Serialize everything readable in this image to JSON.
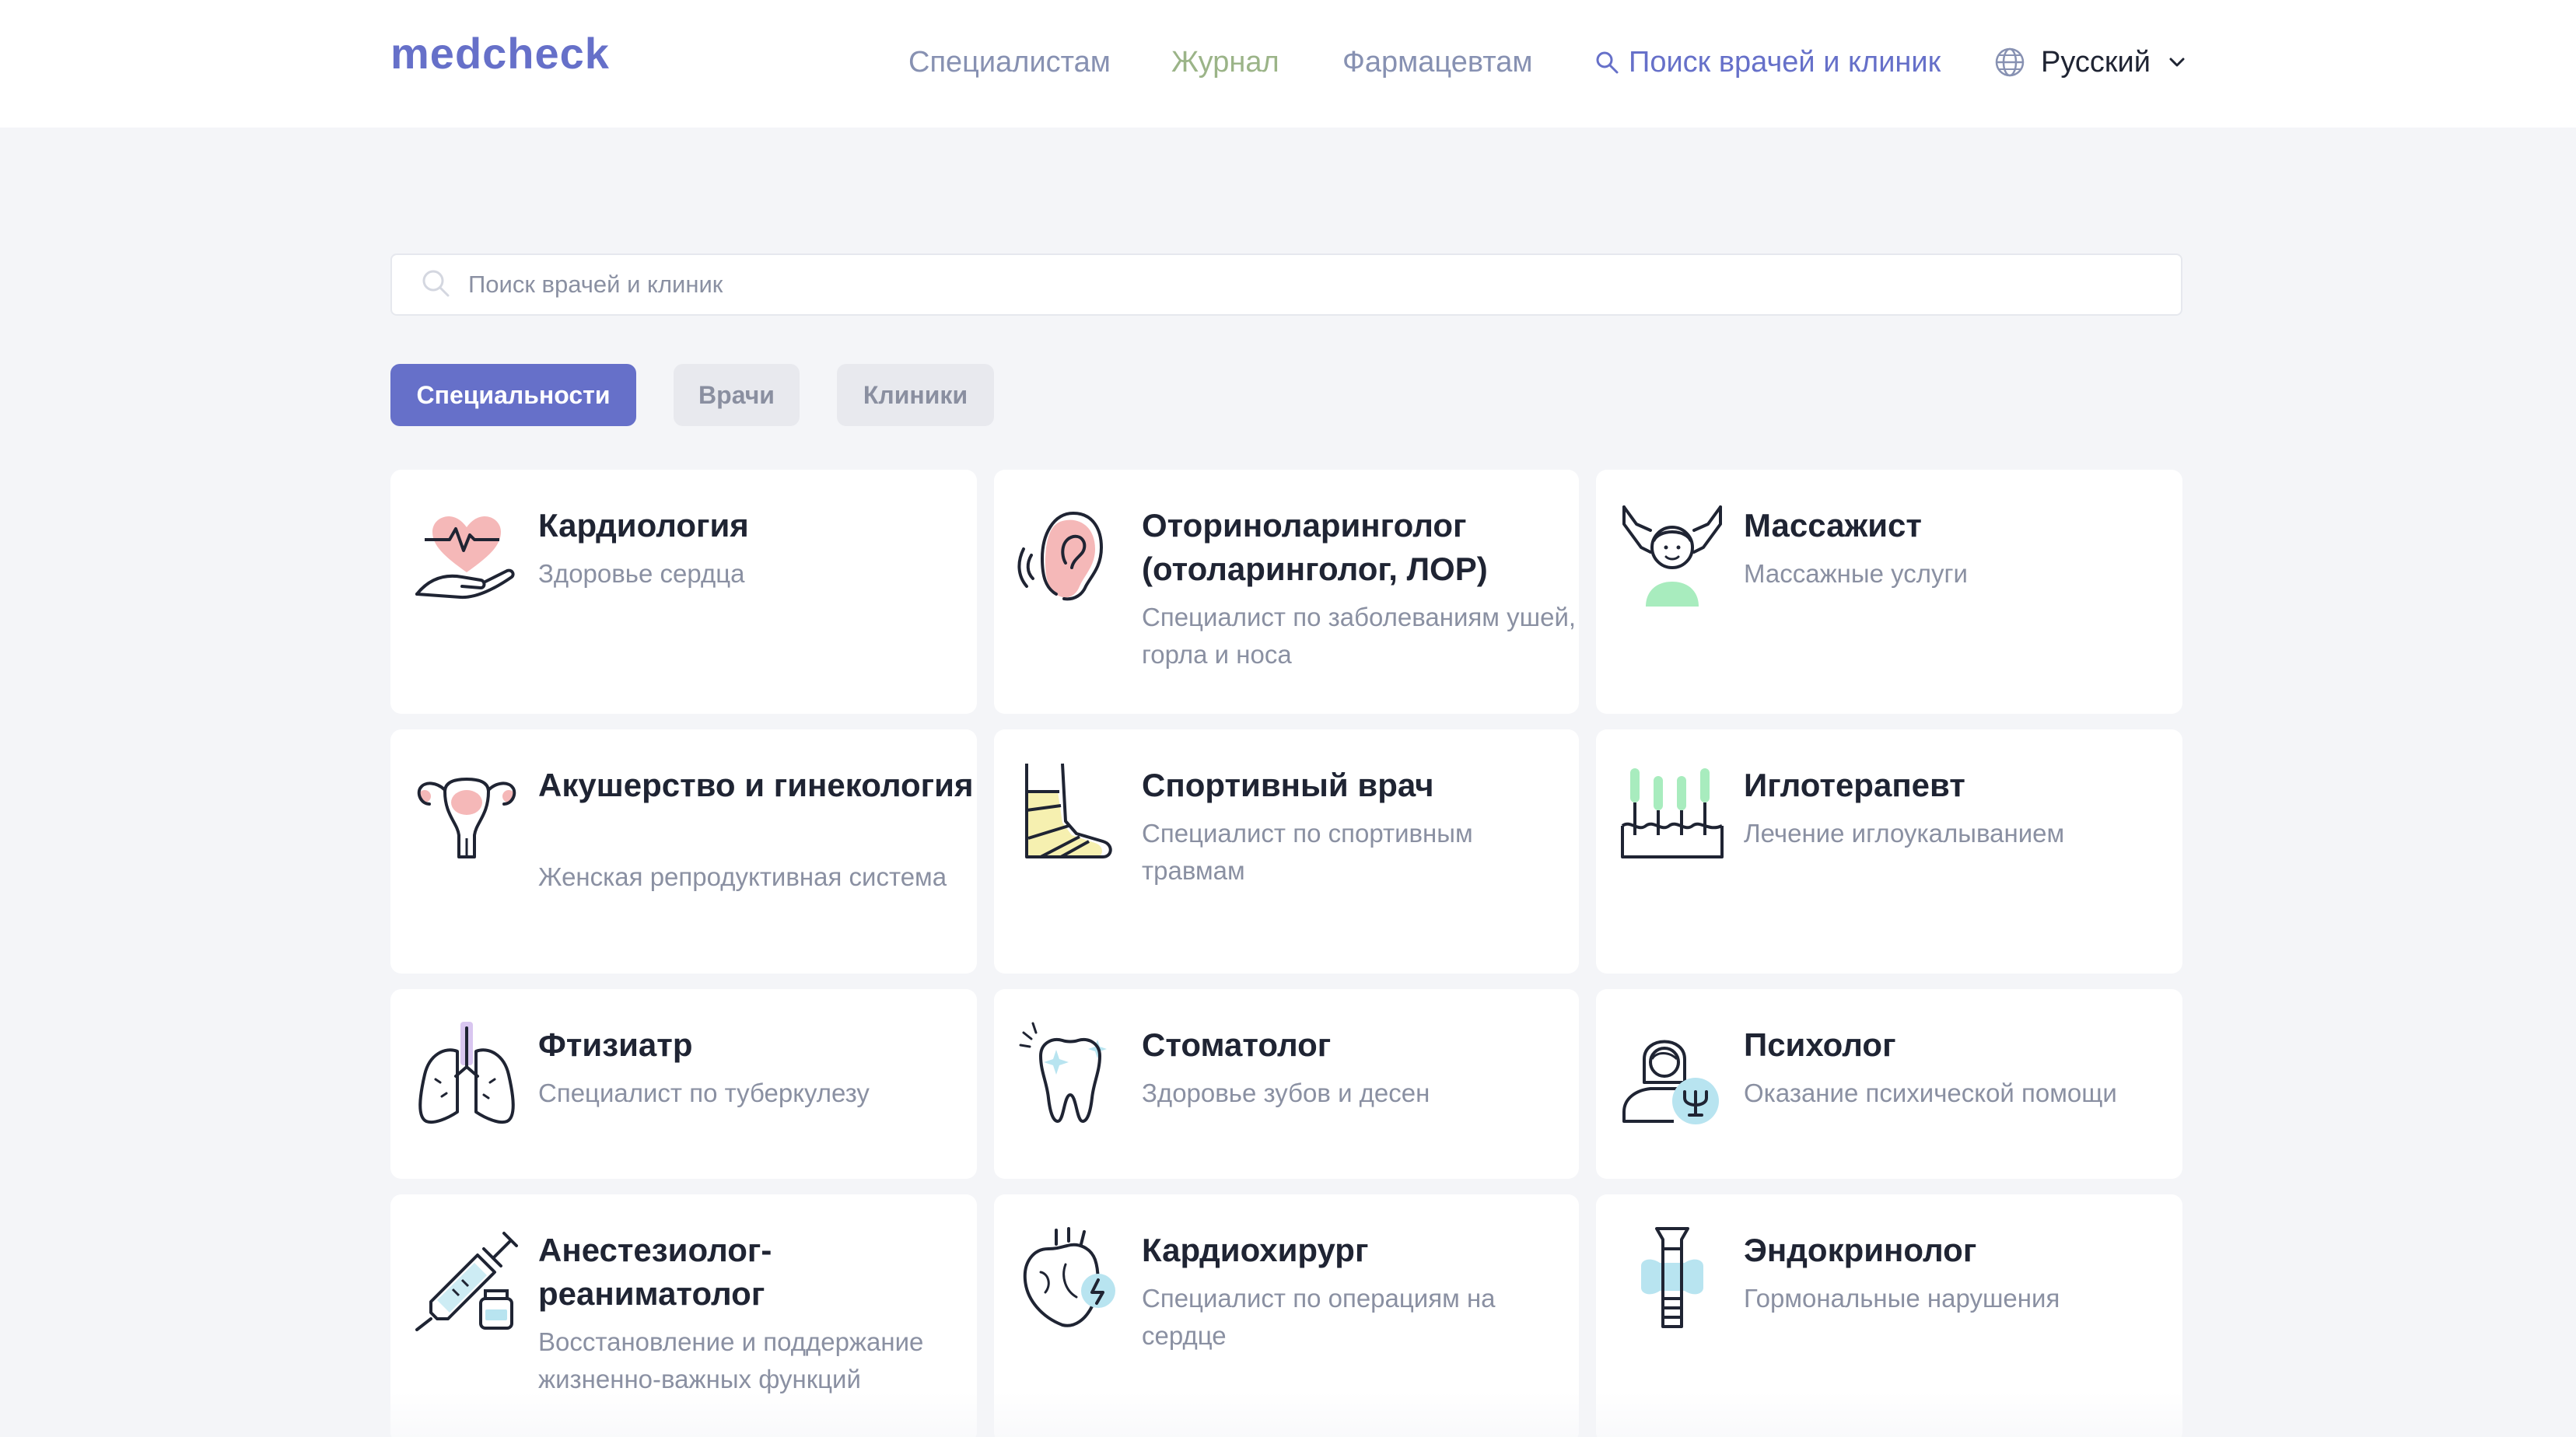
{
  "header": {
    "logo": "medcheck",
    "nav": {
      "specialists": "Специалистам",
      "journal": "Журнал",
      "pharmacists": "Фармацевтам",
      "search": "Поиск врачей и клиник",
      "language": "Русский"
    }
  },
  "search": {
    "placeholder": "Поиск врачей и клиник"
  },
  "tabs": [
    {
      "label": "Специальности",
      "active": true
    },
    {
      "label": "Врачи",
      "active": false
    },
    {
      "label": "Клиники",
      "active": false
    }
  ],
  "specialties": [
    {
      "title": "Кардиология",
      "desc": "Здоровье сердца",
      "icon": "heart-hand-icon"
    },
    {
      "title": "Оториноларинголог (отоларинголог, ЛОР)",
      "desc": "Специалист по заболеваниям ушей, горла и носа",
      "icon": "ear-icon"
    },
    {
      "title": "Массажист",
      "desc": "Массажные услуги",
      "icon": "massage-icon"
    },
    {
      "title": "Акушерство и гинекология",
      "desc": "Женская репродуктивная система",
      "icon": "uterus-icon"
    },
    {
      "title": "Спортивный врач",
      "desc": "Специалист по спортивным травмам",
      "icon": "bandaged-foot-icon"
    },
    {
      "title": "Иглотерапевт",
      "desc": "Лечение иглоукалыванием",
      "icon": "acupuncture-needles-icon"
    },
    {
      "title": "Фтизиатр",
      "desc": "Специалист по туберкулезу",
      "icon": "lungs-icon"
    },
    {
      "title": "Стоматолог",
      "desc": "Здоровье зубов и десен",
      "icon": "tooth-icon"
    },
    {
      "title": "Психолог",
      "desc": "Оказание психической помощи",
      "icon": "psychologist-icon"
    },
    {
      "title": "Анестезиолог-реаниматолог",
      "desc": "Восстановление и поддержание жизненно-важных функций",
      "icon": "syringe-vial-icon"
    },
    {
      "title": "Кардиохирург",
      "desc": "Специалист по операциям на сердце",
      "icon": "heart-surgery-icon"
    },
    {
      "title": "Эндокринолог",
      "desc": "Гормональные нарушения",
      "icon": "thyroid-icon"
    }
  ],
  "colors": {
    "accent": "#6670c9",
    "journal": "#9bb488",
    "pink": "#f5b8b8",
    "mint": "#a8ecbe",
    "lavender": "#d9c6f0",
    "sky": "#b8e4f0",
    "butter": "#f6f0b0"
  }
}
